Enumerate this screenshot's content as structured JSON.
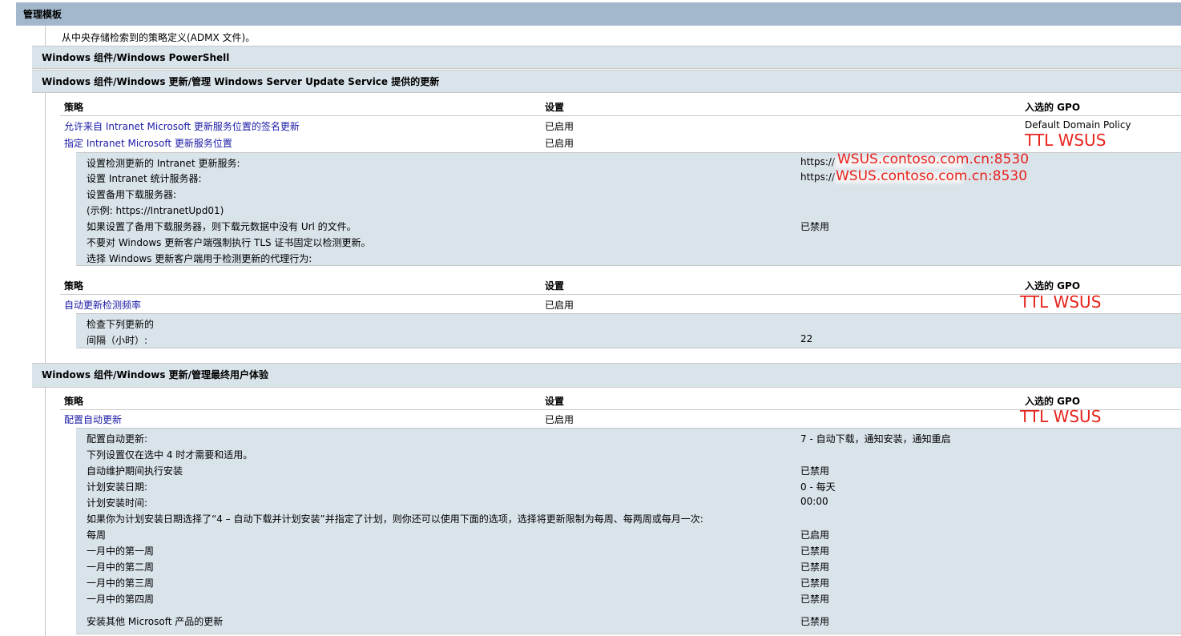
{
  "main_header": "管理模板",
  "description": "从中央存储检索到的策略定义(ADMX 文件)。",
  "sections": {
    "powershell": "Windows 组件/Windows PowerShell",
    "wsus": "Windows 组件/Windows 更新/管理 Windows Server Update Service 提供的更新",
    "enduser": "Windows 组件/Windows 更新/管理最终用户体验"
  },
  "columns": {
    "policy": "策略",
    "setting": "设置",
    "gpo": "入选的 GPO"
  },
  "wsus_table": {
    "row1": {
      "name": "允许来自 Intranet Microsoft 更新服务位置的签名更新",
      "state": "已启用",
      "gpo": "Default Domain Policy"
    },
    "row2": {
      "name": "指定 Intranet Microsoft 更新服务位置",
      "state": "已启用",
      "gpo": "TTL WSUS"
    },
    "details": [
      {
        "label": "设置检测更新的 Intranet 更新服务:",
        "value": "https://",
        "value_red": "WSUS.contoso.com.cn:8530"
      },
      {
        "label": "设置 Intranet 统计服务器:",
        "value": "https://",
        "value_red": "WSUS.contoso.com.cn:8530"
      },
      {
        "label": "设置备用下载服务器:",
        "value": ""
      },
      {
        "label": "(示例:  https://IntranetUpd01)",
        "value": ""
      },
      {
        "label": "如果设置了备用下载服务器，则下载元数据中没有 Url 的文件。",
        "value": "已禁用"
      },
      {
        "label": "不要对 Windows 更新客户端强制执行 TLS 证书固定以检测更新。",
        "value": ""
      },
      {
        "label": "选择 Windows 更新客户端用于检测更新的代理行为:",
        "value": ""
      }
    ]
  },
  "freq_table": {
    "row1": {
      "name": "自动更新检测频率",
      "state": "已启用",
      "gpo": "TTL WSUS"
    },
    "details": [
      {
        "label": "检查下列更新的",
        "value": ""
      },
      {
        "label": "间隔（小时）:",
        "value": "22"
      }
    ]
  },
  "enduser_table": {
    "row1": {
      "name": "配置自动更新",
      "state": "已启用",
      "gpo": "TTL WSUS"
    },
    "details": [
      {
        "label": "配置自动更新:",
        "value": "7 - 自动下载，通知安装，通知重启"
      },
      {
        "label": "下列设置仅在选中 4 时才需要和适用。",
        "value": ""
      },
      {
        "label": "自动维护期间执行安装",
        "value": "已禁用"
      },
      {
        "label": "计划安装日期:",
        "value": "0 - 每天"
      },
      {
        "label": "计划安装时间:",
        "value": "00:00"
      },
      {
        "label": "如果你为计划安装日期选择了“4 – 自动下载并计划安装”并指定了计划，则你还可以使用下面的选项，选择将更新限制为每周、每两周或每月一次:",
        "value": ""
      },
      {
        "label": "每周",
        "value": "已启用"
      },
      {
        "label": "一月中的第一周",
        "value": "已禁用"
      },
      {
        "label": "一月中的第二周",
        "value": "已禁用"
      },
      {
        "label": "一月中的第三周",
        "value": "已禁用"
      },
      {
        "label": "一月中的第四周",
        "value": "已禁用"
      },
      {
        "label": "安装其他 Microsoft 产品的更新",
        "value": "已禁用"
      }
    ]
  }
}
